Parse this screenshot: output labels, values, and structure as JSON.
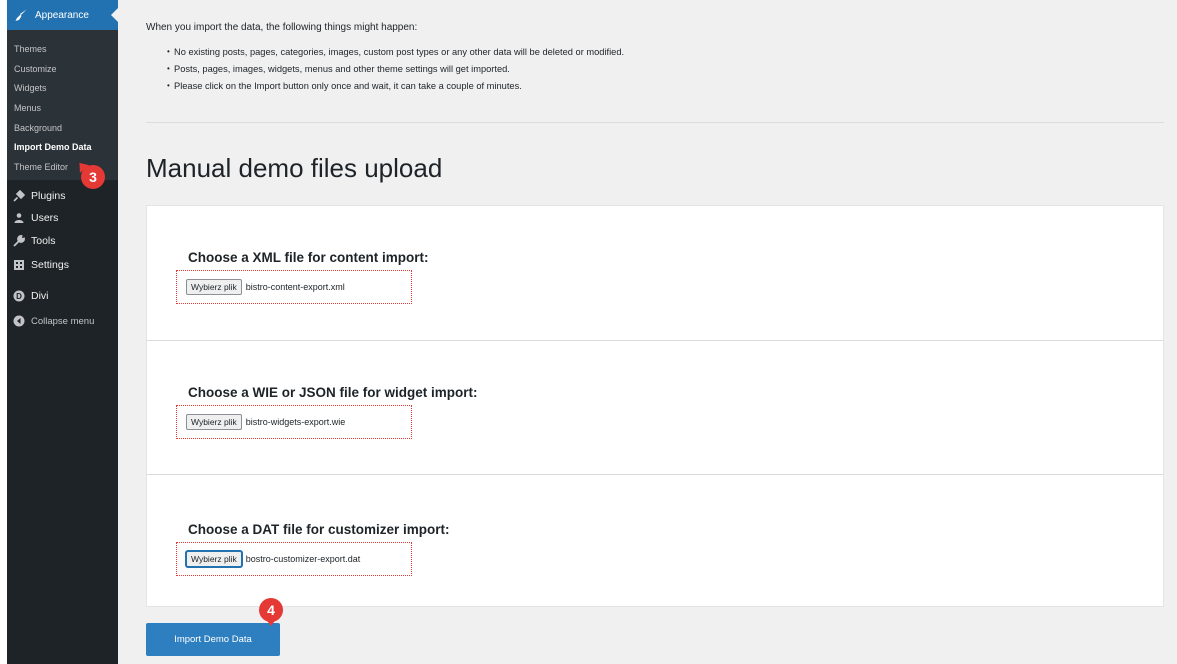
{
  "sidebar": {
    "current_menu": {
      "label": "Appearance",
      "icon": "paintbrush-icon"
    },
    "submenu": [
      {
        "label": "Themes",
        "active": false
      },
      {
        "label": "Customize",
        "active": false
      },
      {
        "label": "Widgets",
        "active": false
      },
      {
        "label": "Menus",
        "active": false
      },
      {
        "label": "Background",
        "active": false
      },
      {
        "label": "Import Demo Data",
        "active": true
      },
      {
        "label": "Theme Editor",
        "active": false
      }
    ],
    "items": [
      {
        "label": "Plugins",
        "icon": "plug-icon"
      },
      {
        "label": "Users",
        "icon": "users-icon"
      },
      {
        "label": "Tools",
        "icon": "wrench-icon"
      },
      {
        "label": "Settings",
        "icon": "settings-icon"
      },
      {
        "label": "Divi",
        "icon": "divi-icon"
      },
      {
        "label": "Collapse menu",
        "icon": "collapse-icon"
      }
    ]
  },
  "main": {
    "intro": "When you import the data, the following things might happen:",
    "bullets": [
      "No existing posts, pages, categories, images, custom post types or any other data will be deleted or modified.",
      "Posts, pages, images, widgets, menus and other theme settings will get imported.",
      "Please click on the Import button only once and wait, it can take a couple of minutes."
    ],
    "section_title": "Manual demo files upload",
    "uploads": [
      {
        "title": "Choose a XML file for content import:",
        "button": "Wybierz plik",
        "file": "bistro-content-export.xml"
      },
      {
        "title": "Choose a WIE or JSON file for widget import:",
        "button": "Wybierz plik",
        "file": "bistro-widgets-export.wie"
      },
      {
        "title": "Choose a DAT file for customizer import:",
        "button": "Wybierz plik",
        "file": "bostro-customizer-export.dat"
      }
    ],
    "import_button": "Import Demo Data"
  },
  "annotations": {
    "step_3": "3",
    "step_4": "4"
  },
  "colors": {
    "sidebar_bg": "#1d2327",
    "accent": "#2271b1",
    "marker": "#e53935",
    "page_bg": "#f0f0f1"
  }
}
